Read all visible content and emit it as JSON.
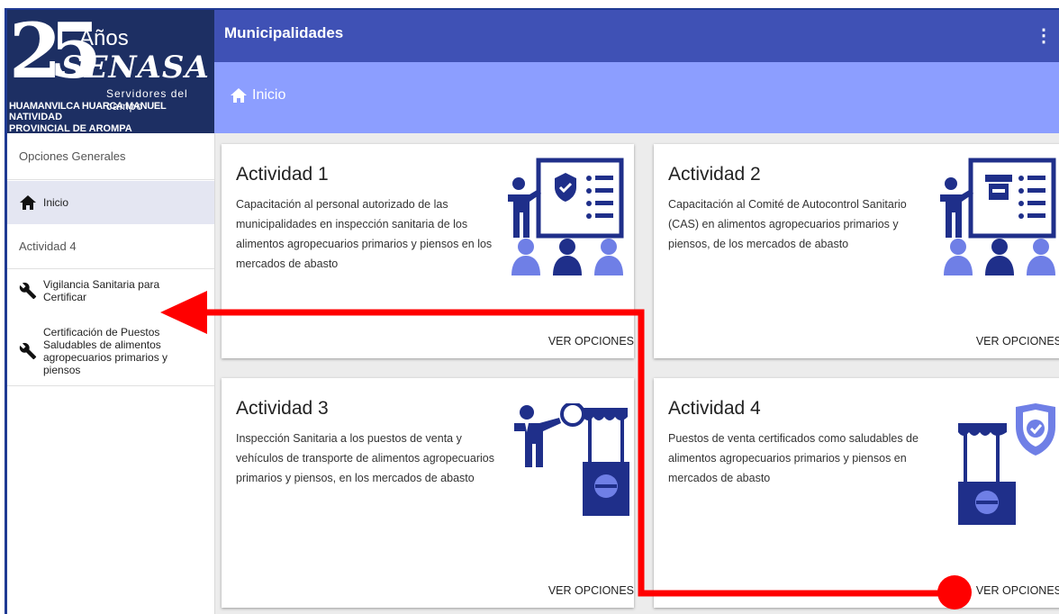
{
  "app": {
    "logo_number": "25",
    "logo_anios": "Años",
    "logo_brand": "SENASA",
    "logo_tagline": "Servidores del campo",
    "user_line1": "HUAMANVILCA HUARCA MANUEL",
    "user_line2": "NATIVIDAD",
    "user_line3": "PROVINCIAL DE AROMPA"
  },
  "header": {
    "title": "Municipalidades",
    "menu_glyph": "⋮"
  },
  "breadcrumb": {
    "label": "Inicio"
  },
  "sidebar": {
    "section_general": "Opciones Generales",
    "inicio_label": "Inicio",
    "section_activity": "Actividad 4",
    "items": [
      {
        "label": "Vigilancia Sanitaria para Certificar"
      },
      {
        "label": "Certificación de Puestos Saludables de alimentos agropecuarios primarios y piensos"
      }
    ]
  },
  "cards": [
    {
      "title": "Actividad 1",
      "desc": "Capacitación al personal autorizado de las municipalidades en inspección sanitaria de los alimentos agropecuarios primarios y piensos en los mercados de abasto",
      "button": "VER OPCIONES"
    },
    {
      "title": "Actividad 2",
      "desc": "Capacitación al Comité de Autocontrol Sanitario (CAS) en alimentos agropecuarios primarios y piensos, de los mercados de abasto",
      "button": "VER OPCIONES"
    },
    {
      "title": "Actividad 3",
      "desc": "Inspección Sanitaria a los puestos de venta y vehículos de transporte de alimentos agropecuarios primarios y piensos, en los mercados de abasto",
      "button": "VER OPCIONES"
    },
    {
      "title": "Actividad 4",
      "desc": "Puestos de venta certificados como saludables de alimentos agropecuarios primarios y piensos en mercados de abasto",
      "button": "VER OPCIONES"
    }
  ],
  "colors": {
    "primary": "#3f51b5",
    "subbar": "#8c9eff",
    "annotation": "#ff0000",
    "illustration": "#1f2f8a"
  }
}
